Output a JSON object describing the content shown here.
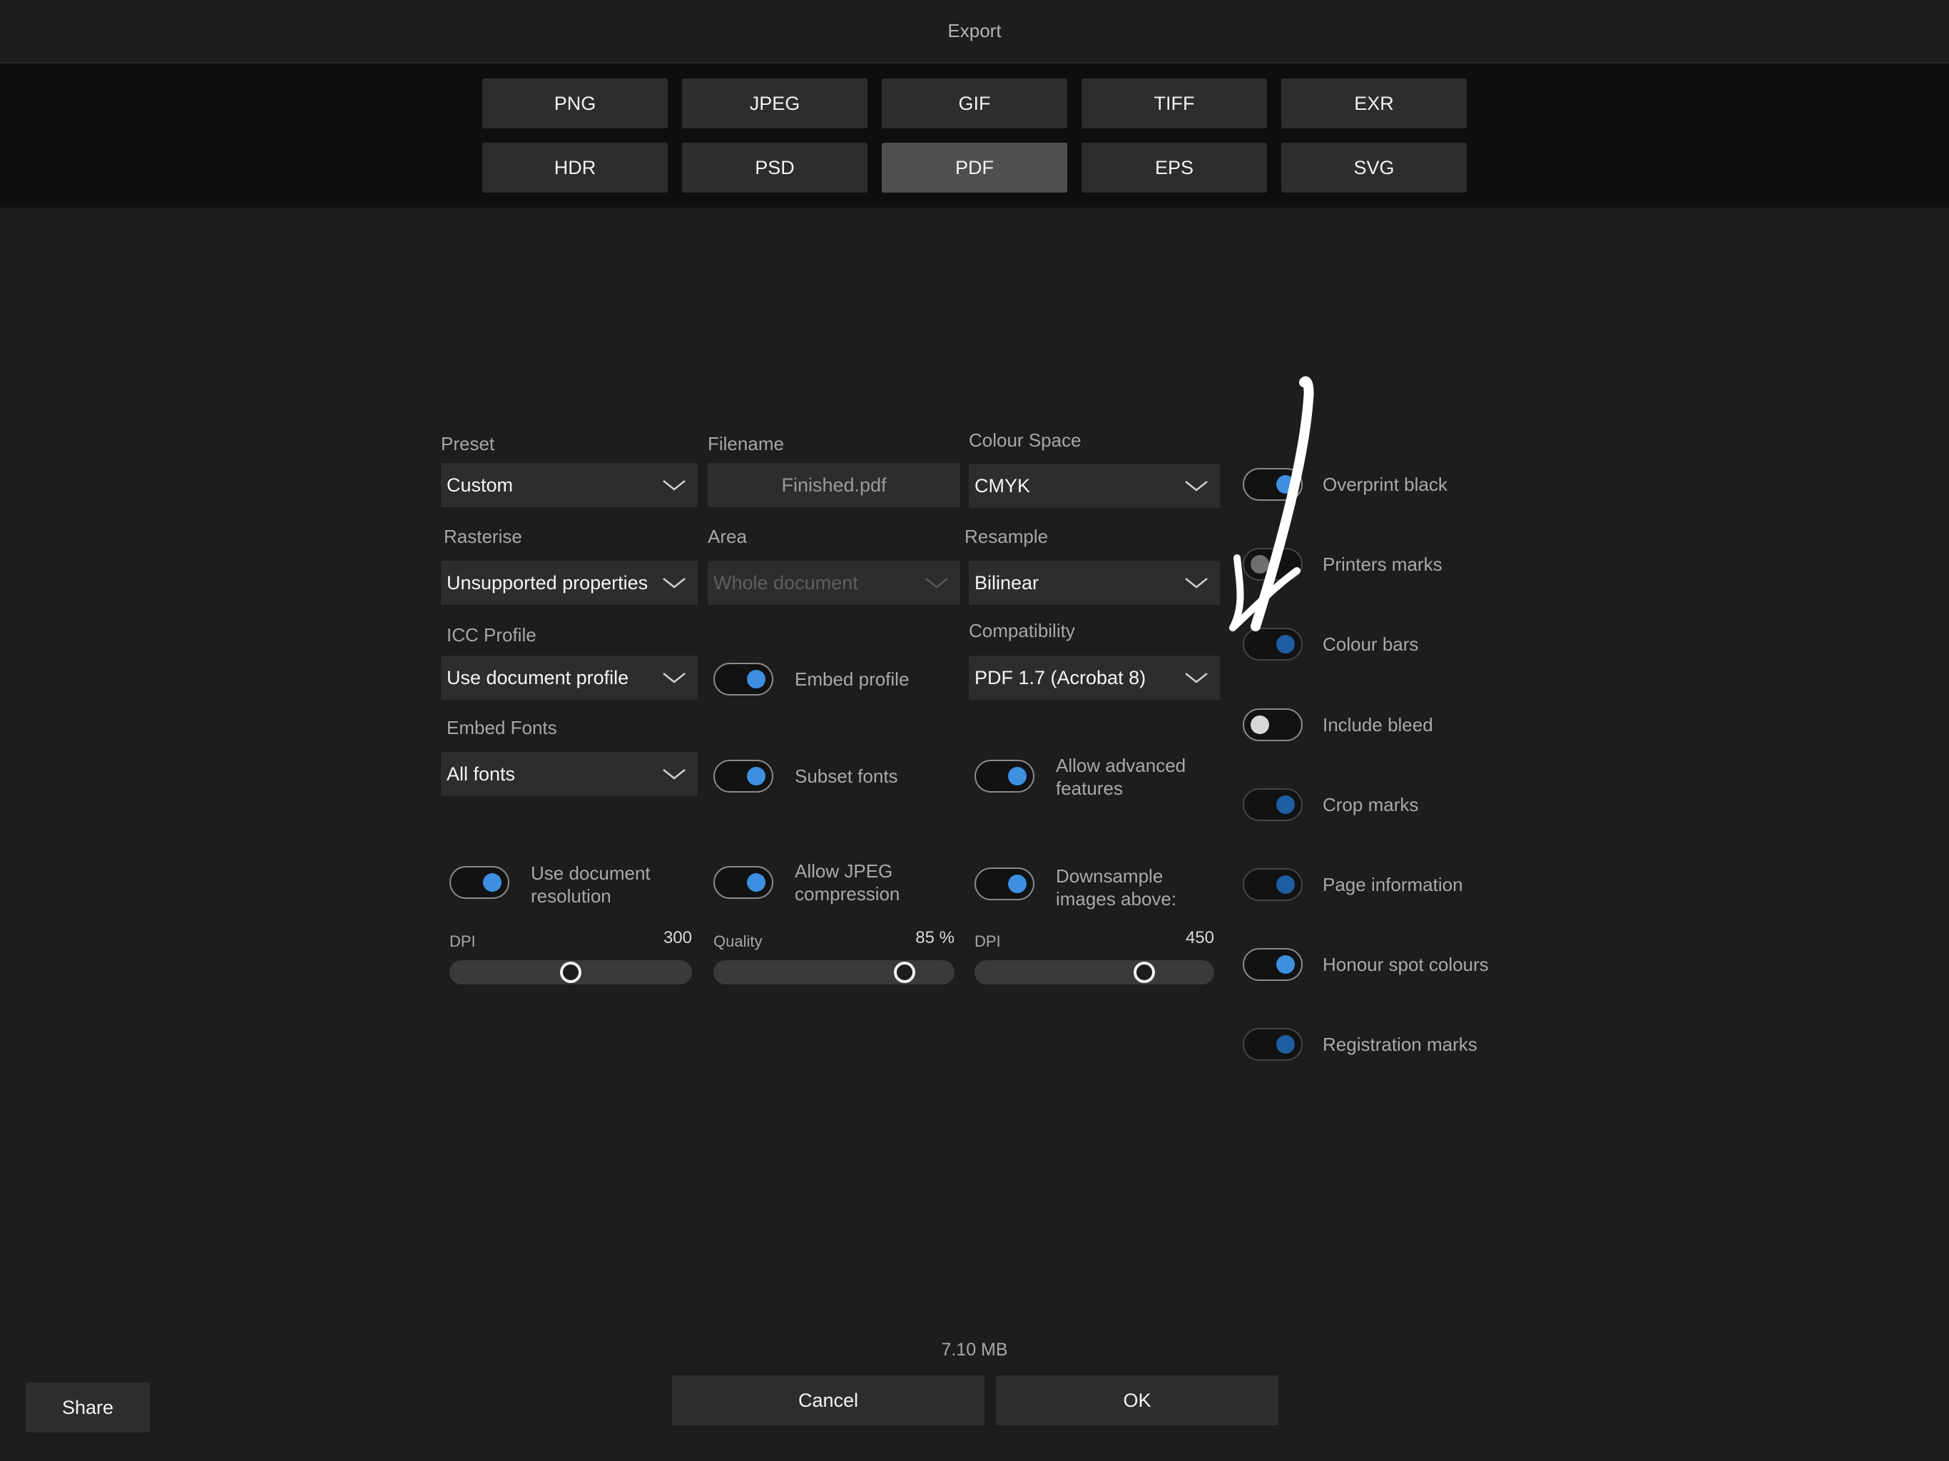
{
  "header": {
    "title": "Export"
  },
  "formats": {
    "row1": [
      "PNG",
      "JPEG",
      "GIF",
      "TIFF",
      "EXR"
    ],
    "row2": [
      "HDR",
      "PSD",
      "PDF",
      "EPS",
      "SVG"
    ],
    "selected": "PDF"
  },
  "preset": {
    "label": "Preset",
    "value": "Custom"
  },
  "filename": {
    "label": "Filename",
    "value": "Finished.pdf"
  },
  "colour_space": {
    "label": "Colour Space",
    "value": "CMYK"
  },
  "rasterise": {
    "label": "Rasterise",
    "value": "Unsupported properties"
  },
  "area": {
    "label": "Area",
    "value": "Whole document"
  },
  "resample": {
    "label": "Resample",
    "value": "Bilinear"
  },
  "icc_profile": {
    "label": "ICC Profile",
    "value": "Use document profile"
  },
  "embed_profile": {
    "label": "Embed profile",
    "on": true
  },
  "compatibility": {
    "label": "Compatibility",
    "value": "PDF 1.7 (Acrobat 8)"
  },
  "embed_fonts": {
    "label": "Embed Fonts",
    "value": "All fonts"
  },
  "subset_fonts": {
    "label": "Subset fonts",
    "on": true
  },
  "advanced": {
    "line1": "Allow advanced",
    "line2": "features",
    "on": true
  },
  "doc_resolution": {
    "line1": "Use document",
    "line2": "resolution",
    "on": true
  },
  "jpeg_compression": {
    "line1": "Allow JPEG",
    "line2": "compression",
    "on": true
  },
  "downsample": {
    "line1": "Downsample",
    "line2": "images above:",
    "on": true
  },
  "dpi_slider": {
    "label": "DPI",
    "value": "300",
    "fraction": 0.5
  },
  "quality_slider": {
    "label": "Quality",
    "value": "85 %",
    "fraction": 0.82
  },
  "downsample_slider": {
    "label": "DPI",
    "value": "450",
    "fraction": 0.73
  },
  "right_toggles": [
    {
      "label": "Overprint black",
      "state": "on"
    },
    {
      "label": "Printers marks",
      "state": "off"
    },
    {
      "label": "Colour bars",
      "state": "dim"
    },
    {
      "label": "Include bleed",
      "state": "off-bright"
    },
    {
      "label": "Crop marks",
      "state": "dim"
    },
    {
      "label": "Page information",
      "state": "dim"
    },
    {
      "label": "Honour spot colours",
      "state": "on"
    },
    {
      "label": "Registration marks",
      "state": "dim"
    }
  ],
  "file_size": "7.10 MB",
  "buttons": {
    "cancel": "Cancel",
    "ok": "OK",
    "share": "Share"
  }
}
